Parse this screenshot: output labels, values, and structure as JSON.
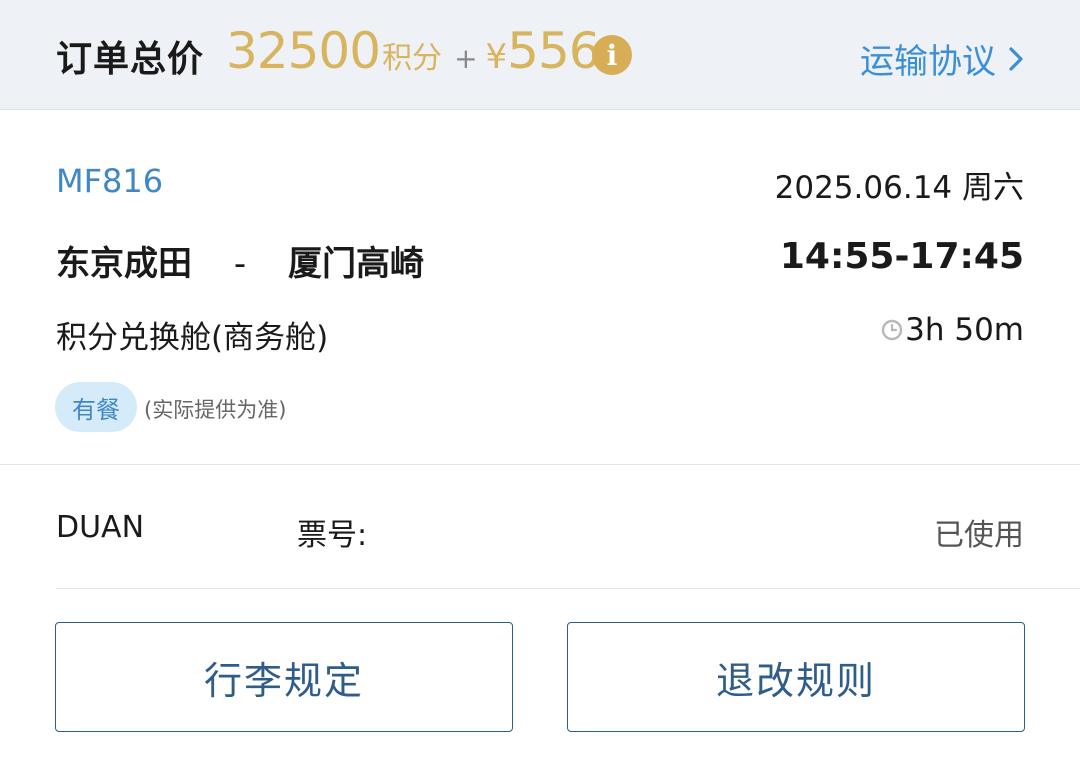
{
  "header": {
    "total_label": "订单总价",
    "points_value": "32500",
    "points_unit": "积分",
    "plus": "+",
    "currency": "¥",
    "cash_value": "556",
    "info_icon": "info-icon",
    "agreement_label": "运输协议",
    "agreement_icon": "chevron-right-icon",
    "accent_color": "#d9b45f",
    "link_color": "#3a8fd6"
  },
  "flight": {
    "number": "MF816",
    "date": "2025.06.14 周六",
    "origin": "东京成田",
    "separator": "-",
    "destination": "厦门高崎",
    "time": "14:55-17:45",
    "cabin": "积分兑换舱(商务舱)",
    "duration_icon": "clock-icon",
    "duration": "3h 50m",
    "meal_badge": "有餐",
    "meal_note": "(实际提供为准)"
  },
  "passenger": {
    "name": "DUAN",
    "ticket_label": "票号:",
    "status": "已使用"
  },
  "actions": {
    "baggage_label": "行李规定",
    "refund_label": "退改规则",
    "button_color": "#2f5d8a"
  }
}
